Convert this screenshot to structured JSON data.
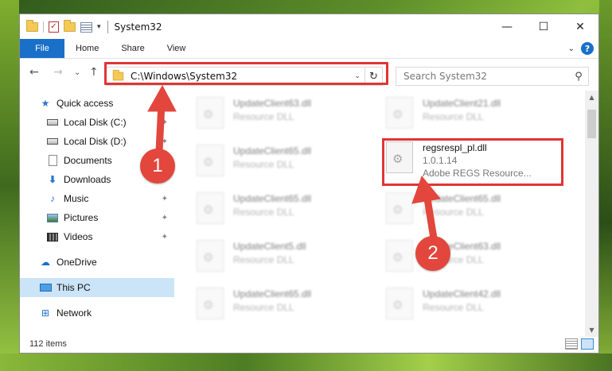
{
  "window": {
    "title": "System32",
    "controls": {
      "minimize": "—",
      "maximize": "☐",
      "close": "✕"
    }
  },
  "ribbon": {
    "tabs": [
      "File",
      "Home",
      "Share",
      "View"
    ],
    "expand_glyph": "⌄",
    "help_glyph": "?"
  },
  "navigation": {
    "back": "←",
    "forward": "→",
    "recent": "⌄",
    "up": "↑",
    "address": "C:\\Windows\\System32",
    "address_dropdown": "⌄",
    "refresh": "↻",
    "search_placeholder": "Search System32"
  },
  "sidebar": {
    "items": [
      {
        "label": "Quick access",
        "icon": "star-icon",
        "pinned": false
      },
      {
        "label": "Local Disk (C:)",
        "icon": "drive-icon",
        "pinned": true
      },
      {
        "label": "Local Disk (D:)",
        "icon": "drive-icon",
        "pinned": true
      },
      {
        "label": "Documents",
        "icon": "documents-icon",
        "pinned": true
      },
      {
        "label": "Downloads",
        "icon": "downloads-icon",
        "pinned": true
      },
      {
        "label": "Music",
        "icon": "music-icon",
        "pinned": true
      },
      {
        "label": "Pictures",
        "icon": "pictures-icon",
        "pinned": true
      },
      {
        "label": "Videos",
        "icon": "videos-icon",
        "pinned": true
      },
      {
        "label": "OneDrive",
        "icon": "cloud-icon",
        "pinned": false
      },
      {
        "label": "This PC",
        "icon": "computer-icon",
        "pinned": false,
        "selected": true
      },
      {
        "label": "Network",
        "icon": "network-icon",
        "pinned": false
      }
    ],
    "pin_glyph": "📌"
  },
  "files": {
    "left_column": [
      {
        "name": "UpdateClient63.dll",
        "type": "Resource DLL"
      },
      {
        "name": "UpdateClient65.dll",
        "type": "Resource DLL"
      },
      {
        "name": "UpdateClient65.dll",
        "type": "Resource DLL"
      },
      {
        "name": "UpdateClient5.dll",
        "type": "Resource DLL"
      },
      {
        "name": "UpdateClient65.dll",
        "type": "Resource DLL"
      }
    ],
    "right_column": [
      {
        "name": "UpdateClient21.dll",
        "type": "Resource DLL"
      },
      {
        "name": "regsrespl_pl.dll",
        "version": "1.0.1.14",
        "type": "Adobe REGS Resource...",
        "highlighted": true
      },
      {
        "name": "UpdateClient65.dll",
        "type": "Resource DLL"
      },
      {
        "name": "UpdateClient63.dll",
        "type": "Resource DLL"
      },
      {
        "name": "UpdateClient42.dll",
        "type": "Resource DLL"
      }
    ]
  },
  "status": {
    "item_count": "112 items"
  },
  "annotations": {
    "step1": "1",
    "step2": "2"
  },
  "colors": {
    "accent": "#1a6fc9",
    "highlight": "#e03535",
    "selection": "#cce4f7"
  }
}
